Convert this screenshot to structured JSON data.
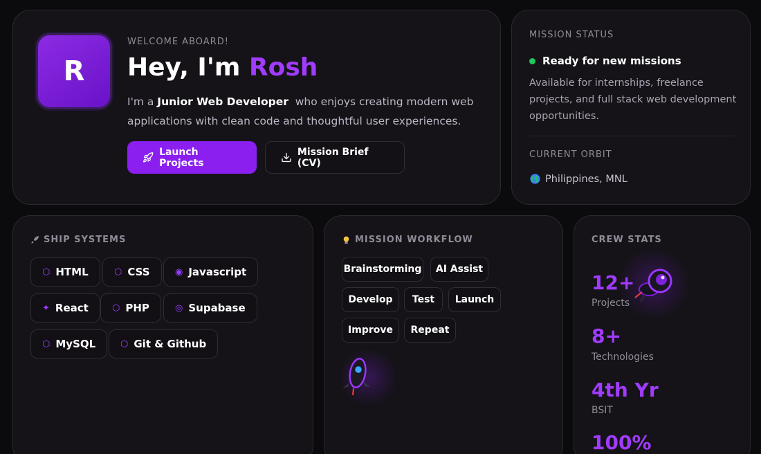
{
  "hero": {
    "avatar_letter": "R",
    "eyebrow": "WELCOME ABOARD!",
    "title_prefix": "Hey, I'm ",
    "title_name": "Rosh",
    "desc_prefix": "I'm a ",
    "desc_role": "Junior Web Developer",
    "desc_suffix": "  who enjoys creating modern web applications with clean code and thoughtful user experiences.",
    "primary_button": "Launch Projects",
    "secondary_button": "Mission Brief (CV)"
  },
  "status": {
    "title": "MISSION STATUS",
    "ready_text": "Ready for new missions",
    "availability": "Available for internships, freelance projects, and full stack web development opportunities.",
    "orbit_title": "CURRENT ORBIT",
    "location": "Philippines, MNL",
    "status_color": "#22c55e"
  },
  "systems": {
    "title": "SHIP SYSTEMS",
    "items": [
      {
        "label": "HTML",
        "icon": "hexagon-icon"
      },
      {
        "label": "CSS",
        "icon": "hexagon-icon"
      },
      {
        "label": "Javascript",
        "icon": "target-icon"
      },
      {
        "label": "React",
        "icon": "sparkle-icon"
      },
      {
        "label": "PHP",
        "icon": "hexagon-icon"
      },
      {
        "label": "Supabase",
        "icon": "ring-icon"
      },
      {
        "label": "MySQL",
        "icon": "hexagon-icon"
      },
      {
        "label": "Git & Github",
        "icon": "hexagon-icon"
      }
    ]
  },
  "workflow": {
    "title": "MISSION WORKFLOW",
    "steps": [
      "Brainstorming",
      "AI Assist",
      "Develop",
      "Test",
      "Launch",
      "Improve",
      "Repeat"
    ]
  },
  "stats": {
    "title": "CREW STATS",
    "items": [
      {
        "value": "12+",
        "label": "Projects"
      },
      {
        "value": "8+",
        "label": "Technologies"
      },
      {
        "value": "4th Yr",
        "label": "BSIT"
      },
      {
        "value": "100%",
        "label": ""
      }
    ]
  },
  "colors": {
    "accent": "#a03bff",
    "button": "#8a1ff0",
    "background": "#0b0a0d",
    "card": "#151318"
  }
}
